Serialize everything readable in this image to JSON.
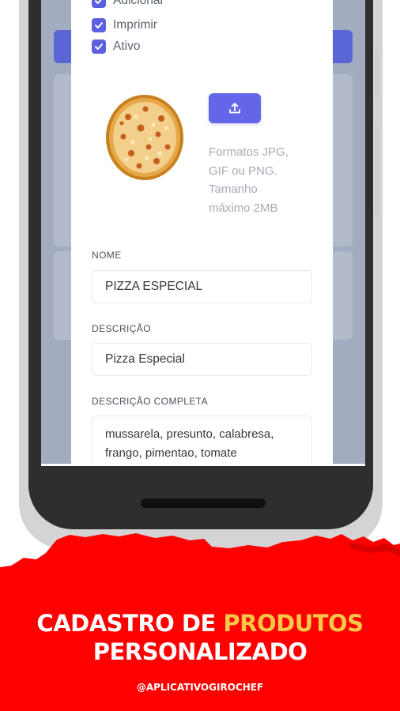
{
  "form": {
    "checkboxes": [
      {
        "label": "Adicional",
        "checked": true
      },
      {
        "label": "Imprimir",
        "checked": true
      },
      {
        "label": "Ativo",
        "checked": true
      }
    ],
    "image_hint": [
      "Formatos JPG,",
      "GIF ou PNG.",
      "Tamanho",
      "máximo 2MB"
    ],
    "nome_label": "NOME",
    "nome_value": "PIZZA ESPECIAL",
    "descricao_label": "DESCRIÇÃO",
    "descricao_value": "Pizza Especial",
    "descricao_completa_label": "DESCRIÇÃO COMPLETA",
    "descricao_completa_lines": [
      "mussarela, presunto, calabresa,",
      "frango, pimentao, tomate"
    ]
  },
  "banner": {
    "line1_a": "CADASTRO DE ",
    "line1_b": "PRODUTOS",
    "line2": "PERSONALIZADO",
    "handle": "@APLICATIVOGIROCHEF"
  },
  "colors": {
    "accent": "#6366e8",
    "banner_red": "#ff0000",
    "highlight_yellow": "#f5c84a"
  },
  "icons": {
    "upload": "upload-icon",
    "check": "check-icon"
  }
}
